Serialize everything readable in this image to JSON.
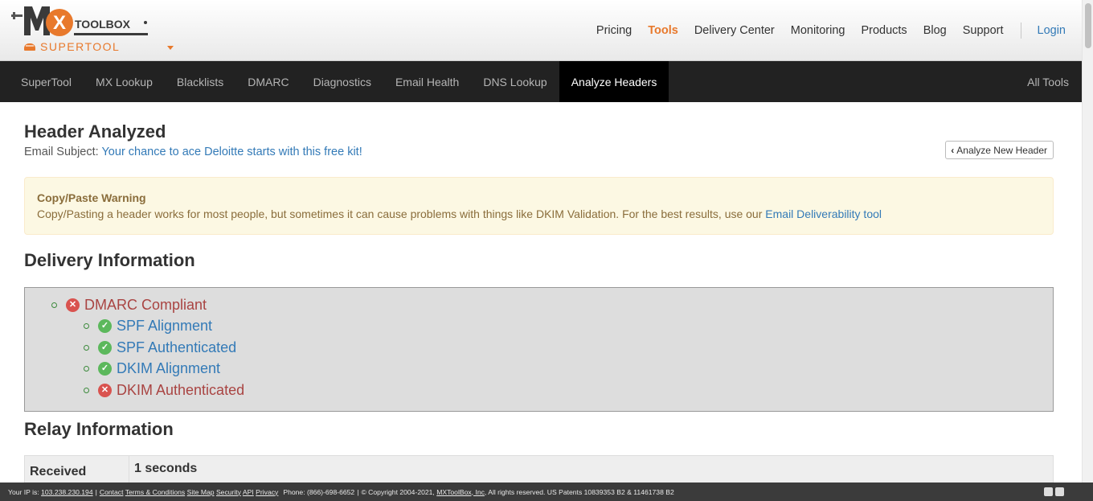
{
  "brand": {
    "logo_text": "MxToolbox",
    "logo_wordmark": "TOOLBOX",
    "logo_mx": "MX",
    "product": "SUPERTOOL"
  },
  "topnav": {
    "items": [
      "Pricing",
      "Tools",
      "Delivery Center",
      "Monitoring",
      "Products",
      "Blog",
      "Support"
    ],
    "active": "Tools",
    "login": "Login",
    "accent_color": "#e8792c"
  },
  "mainnav": {
    "items": [
      "SuperTool",
      "MX Lookup",
      "Blacklists",
      "DMARC",
      "Diagnostics",
      "Email Health",
      "DNS Lookup",
      "Analyze Headers"
    ],
    "active": "Analyze Headers",
    "right": "All Tools"
  },
  "page": {
    "title": "Header Analyzed",
    "subject_label": "Email Subject:",
    "subject_value": "Your chance to ace Deloitte starts with this free kit!",
    "new_header_button": "Analyze New Header"
  },
  "warning": {
    "title": "Copy/Paste Warning",
    "text": "Copy/Pasting a header works for most people, but sometimes it can cause problems with things like DKIM Validation. For the best results, use our",
    "link": "Email Deliverability tool"
  },
  "delivery": {
    "title": "Delivery Information",
    "root": {
      "label": "DMARC Compliant",
      "status": "fail"
    },
    "children": [
      {
        "label": "SPF Alignment",
        "status": "pass"
      },
      {
        "label": "SPF Authenticated",
        "status": "pass"
      },
      {
        "label": "DKIM Alignment",
        "status": "pass"
      },
      {
        "label": "DKIM Authenticated",
        "status": "fail"
      }
    ]
  },
  "relay": {
    "title": "Relay Information",
    "header": "Received Delay:",
    "value": "1 seconds"
  },
  "footer": {
    "ip_label": "Your IP is:",
    "ip": "103.238.230.194",
    "links": [
      "Contact",
      "Terms & Conditions",
      "Site Map",
      "Security",
      "API",
      "Privacy"
    ],
    "phone": "Phone: (866)-698-6652",
    "copyright": "© Copyright 2004-2021,",
    "company": "MXToolBox, Inc",
    "rights": ", All rights reserved. US Patents 10839353 B2 & 11461738 B2"
  }
}
